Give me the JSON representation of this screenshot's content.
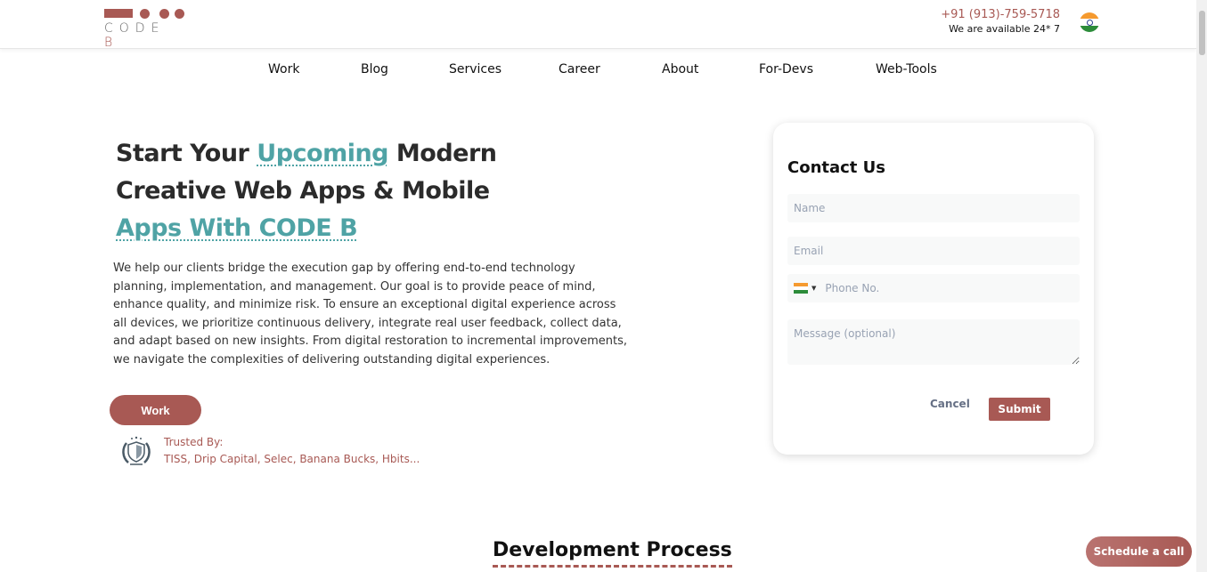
{
  "header": {
    "logo": {
      "text_main": "CODE ",
      "text_accent": "B"
    },
    "phone": "+91 (913)-759-5718",
    "availability": "We are available 24* 7",
    "country_flag_icon": "india-flag-icon"
  },
  "nav": {
    "items": [
      {
        "label": "Work"
      },
      {
        "label": "Blog"
      },
      {
        "label": "Services"
      },
      {
        "label": "Career"
      },
      {
        "label": "About"
      },
      {
        "label": "For-Devs"
      },
      {
        "label": "Web-Tools"
      }
    ]
  },
  "hero": {
    "title_part1": "Start Your ",
    "title_accent1": "Upcoming",
    "title_part2": " Modern",
    "title_line2": "Creative Web Apps & Mobile",
    "title_accent2": "Apps With CODE B",
    "description": "We help our clients bridge the execution gap by offering end-to-end technology planning, implementation, and management. Our goal is to provide peace of mind, enhance quality, and minimize risk. To ensure an exceptional digital experience across all devices, we prioritize continuous delivery, integrate real user feedback, collect data, and adapt based on new insights. From digital restoration to incremental improvements, we navigate the complexities of delivering outstanding digital experiences.",
    "work_button": "Work",
    "trusted_label": "Trusted By:",
    "trusted_list": "TISS, Drip Capital, Selec, Banana Bucks, Hbits..."
  },
  "contact_form": {
    "title": "Contact Us",
    "name_placeholder": "Name",
    "email_placeholder": "Email",
    "phone_placeholder": "Phone No.",
    "message_placeholder": "Message (optional)",
    "cancel_label": "Cancel",
    "submit_label": "Submit"
  },
  "section": {
    "title": "Development Process"
  },
  "floating": {
    "schedule_label": "Schedule a call"
  },
  "colors": {
    "brand": "#a85954",
    "accent": "#4fa3a5"
  }
}
